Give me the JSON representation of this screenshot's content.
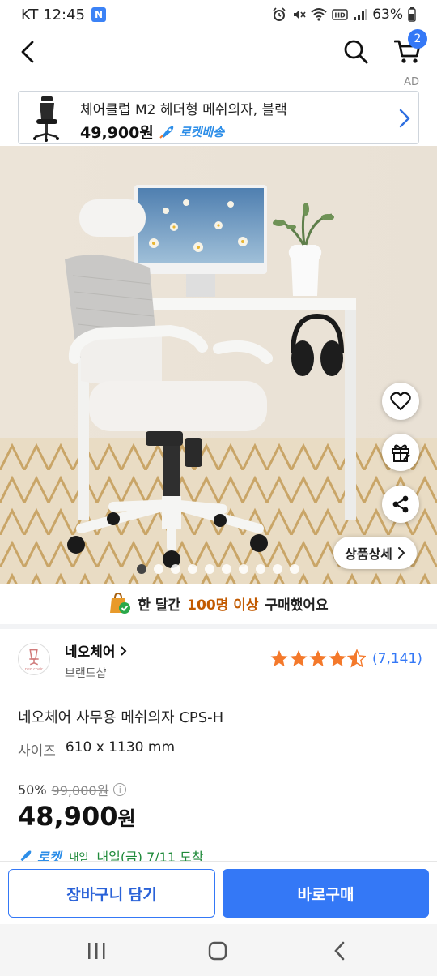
{
  "status_bar": {
    "carrier_time": "KT 12:45",
    "app_badge": "N",
    "battery": "63%"
  },
  "nav": {
    "cart_count": "2"
  },
  "ad": {
    "label": "AD",
    "title": "체어클럽 M2 헤더형 메쉬의자, 블랙",
    "price": "49,900원",
    "delivery": "로켓배송"
  },
  "gallery": {
    "detail_button": "상품상세",
    "image_count": 10,
    "current_index": 0
  },
  "social_proof": {
    "prefix": "한 달간",
    "highlight": "100명 이상",
    "suffix": "구매했어요"
  },
  "brand": {
    "name": "네오체어",
    "logo_text": "neo chair",
    "subtitle": "브랜드샵"
  },
  "rating": {
    "stars": 4.5,
    "count": "(7,141)"
  },
  "product": {
    "title": "네오체어 사무용 메쉬의자 CPS-H",
    "size_label": "사이즈",
    "size_value": "610 x 1130 mm"
  },
  "price": {
    "discount": "50%",
    "original": "99,000원",
    "info_icon": "i",
    "sale_number": "48,900",
    "sale_unit": "원"
  },
  "delivery": {
    "rocket": "로켓",
    "tag": "내일",
    "text": "내일(금) 7/11 도착"
  },
  "actions": {
    "cart_add": "장바구니 담기",
    "buy_now": "바로구매"
  },
  "colors": {
    "primary": "#3478f6",
    "star": "#f4792b",
    "highlight": "#c25a00"
  }
}
